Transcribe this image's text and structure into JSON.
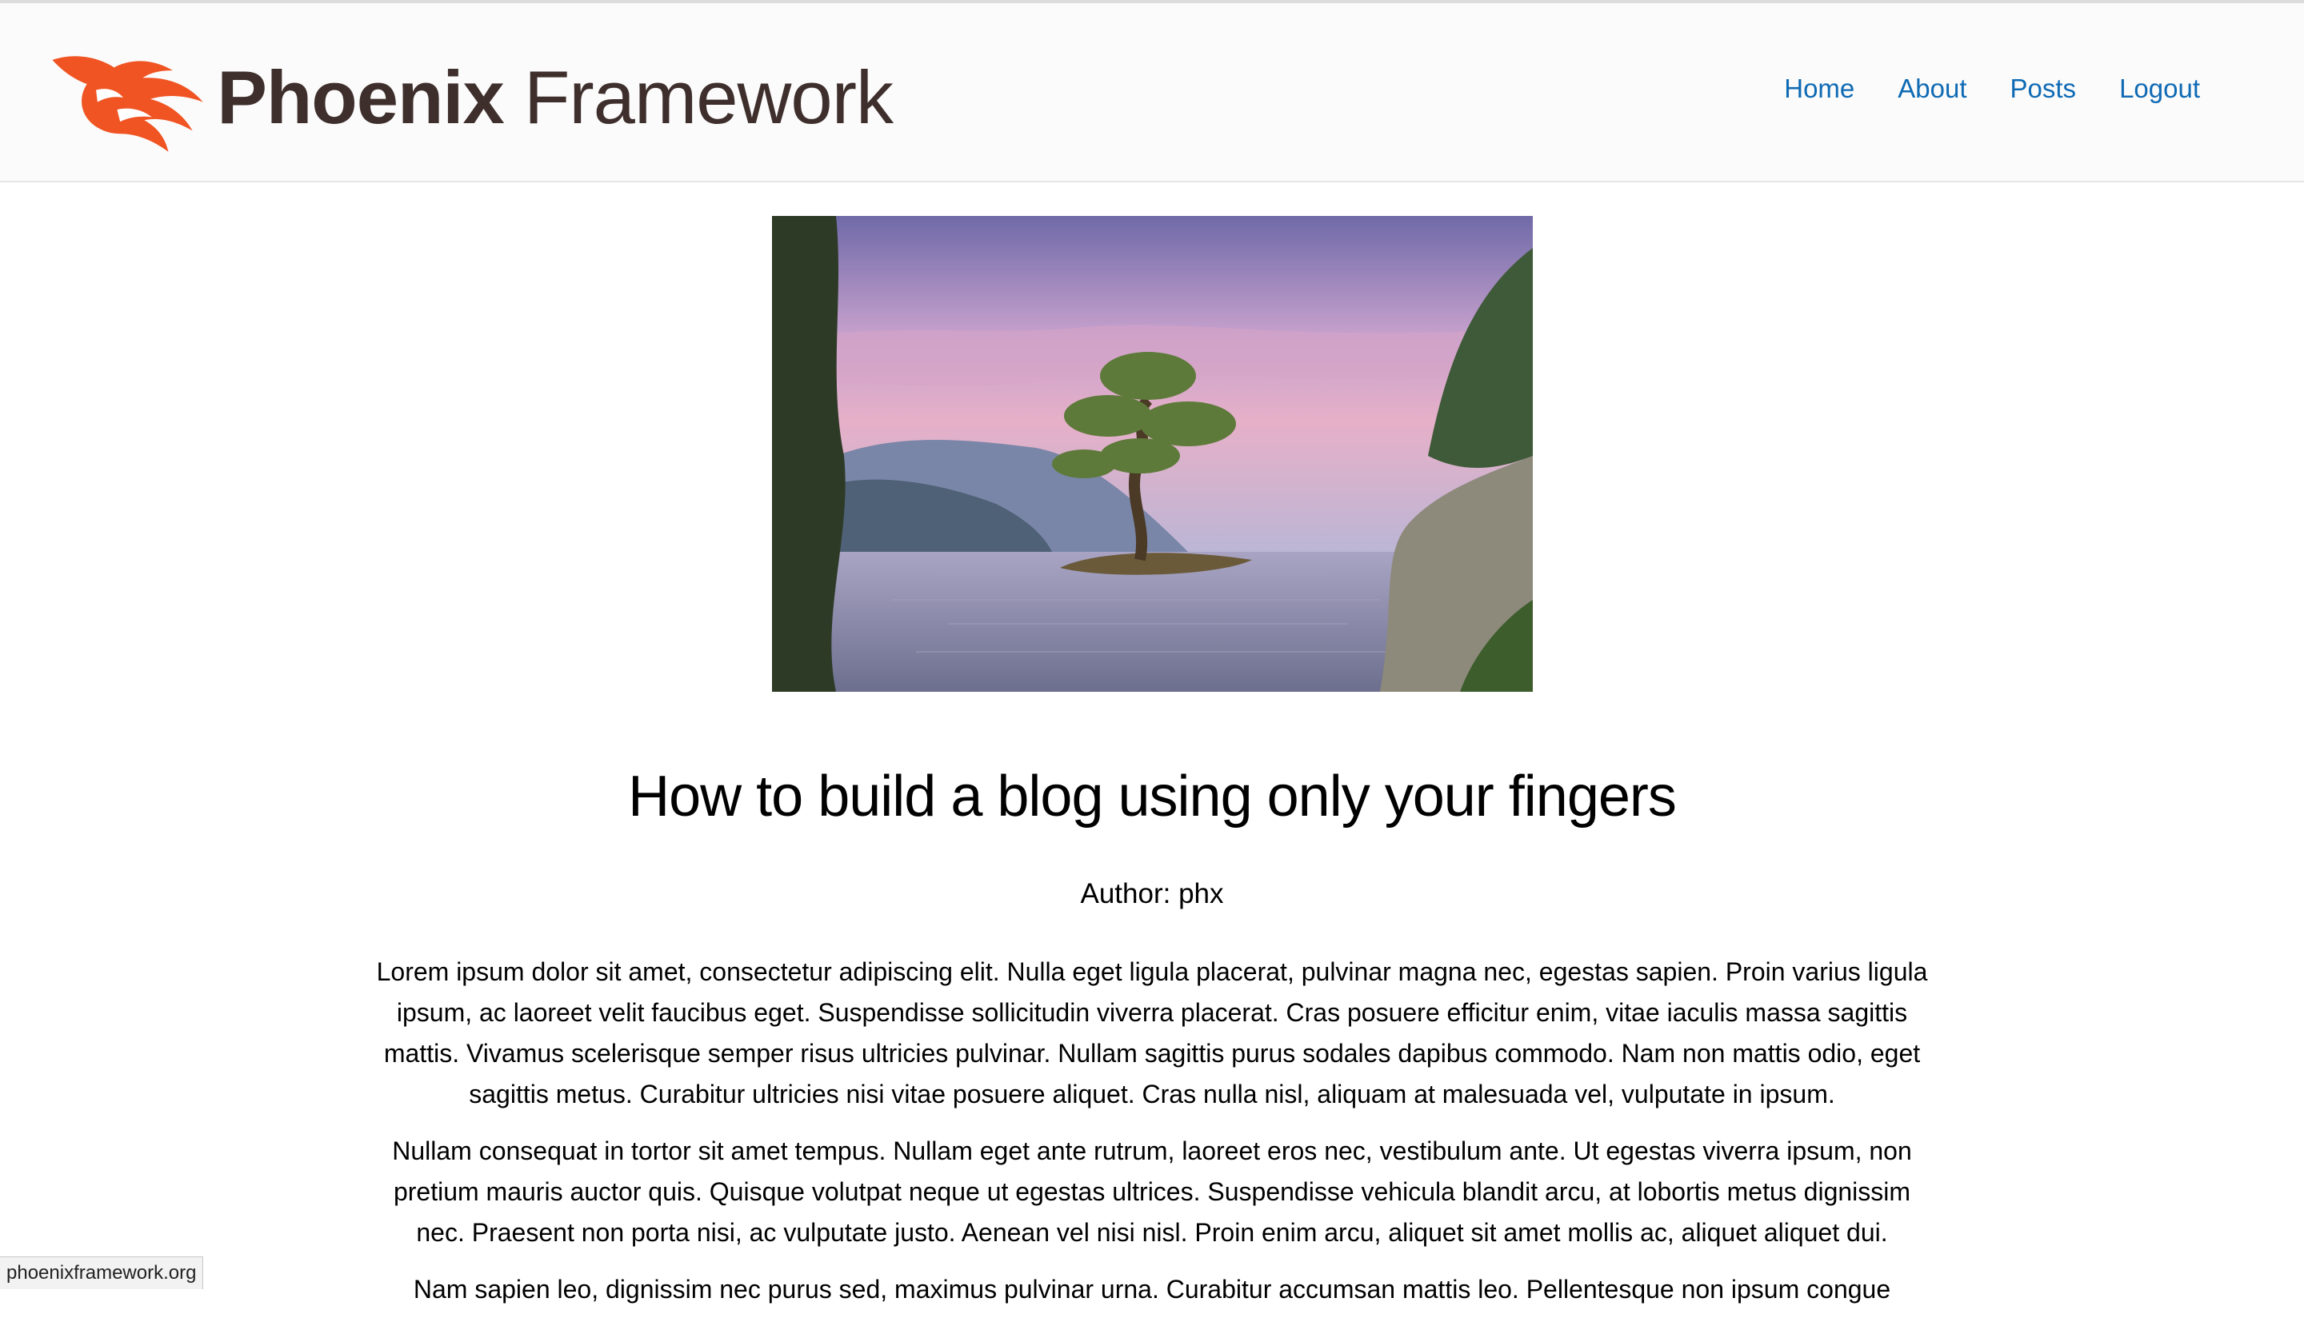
{
  "brand": {
    "name_bold": "Phoenix",
    "name_light": "Framework",
    "brand_color": "#f05423",
    "text_color": "#3e2f2c"
  },
  "nav": {
    "items": [
      {
        "label": "Home"
      },
      {
        "label": "About"
      },
      {
        "label": "Posts"
      },
      {
        "label": "Logout"
      }
    ],
    "link_color": "#0f6ab4"
  },
  "post": {
    "title": "How to build a blog using only your fingers",
    "author": "Author: phx",
    "paragraphs": [
      "Lorem ipsum dolor sit amet, consectetur adipiscing elit. Nulla eget ligula placerat, pulvinar magna nec, egestas sapien. Proin varius ligula ipsum, ac laoreet velit faucibus eget. Suspendisse sollicitudin viverra placerat. Cras posuere efficitur enim, vitae iaculis massa sagittis mattis. Vivamus scelerisque semper risus ultricies pulvinar. Nullam sagittis purus sodales dapibus commodo. Nam non mattis odio, eget sagittis metus. Curabitur ultricies nisi vitae posuere aliquet. Cras nulla nisl, aliquam at malesuada vel, vulputate in ipsum.",
      "Nullam consequat in tortor sit amet tempus. Nullam eget ante rutrum, laoreet eros nec, vestibulum ante. Ut egestas viverra ipsum, non pretium mauris auctor quis. Quisque volutpat neque ut egestas ultrices. Suspendisse vehicula blandit arcu, at lobortis metus dignissim nec. Praesent non porta nisi, ac vulputate justo. Aenean vel nisi nisl. Proin enim arcu, aliquet sit amet mollis ac, aliquet aliquet dui.",
      "Nam sapien leo, dignissim nec purus sed, maximus pulvinar urna. Curabitur accumsan mattis leo. Pellentesque non ipsum congue"
    ]
  },
  "statusbar": {
    "url": "phoenixframework.org"
  }
}
